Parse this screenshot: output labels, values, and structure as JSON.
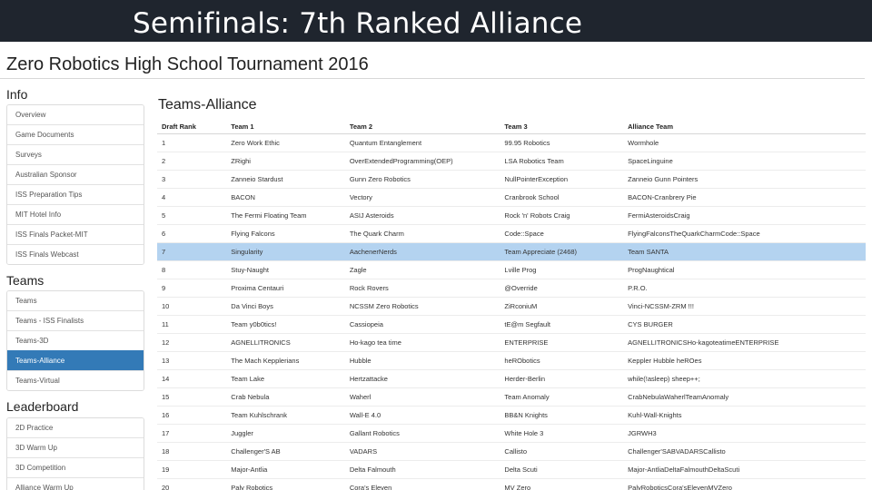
{
  "banner": {
    "title": "Semifinals: 7th Ranked Alliance"
  },
  "site": {
    "title": "Zero Robotics High School Tournament 2016"
  },
  "sidebar": {
    "info": {
      "heading": "Info",
      "items": [
        "Overview",
        "Game Documents",
        "Surveys",
        "Australian Sponsor",
        "ISS Preparation Tips",
        "MIT Hotel Info",
        "ISS Finals Packet-MIT",
        "ISS Finals Webcast"
      ]
    },
    "teams": {
      "heading": "Teams",
      "items": [
        "Teams",
        "Teams - ISS Finalists",
        "Teams-3D",
        "Teams-Alliance",
        "Teams-Virtual"
      ],
      "active": "Teams-Alliance"
    },
    "leaderboard": {
      "heading": "Leaderboard",
      "items": [
        "2D Practice",
        "3D Warm Up",
        "3D Competition",
        "Alliance Warm Up"
      ]
    }
  },
  "main": {
    "heading": "Teams-Alliance",
    "columns": [
      "Draft Rank",
      "Team 1",
      "Team 2",
      "Team 3",
      "Alliance Team"
    ],
    "selected_rank": "7",
    "rows": [
      [
        "1",
        "Zero Work Ethic",
        "Quantum Entanglement",
        "99.95 Robotics",
        "Wormhole"
      ],
      [
        "2",
        "ZRighi",
        "OverExtendedProgramming(OEP)",
        "LSA Robotics Team",
        "SpaceLinguine"
      ],
      [
        "3",
        "Zanneio Stardust",
        "Gunn Zero Robotics",
        "NullPointerException",
        "Zanneio Gunn Pointers"
      ],
      [
        "4",
        "BACON",
        "Vectory",
        "Cranbrook School",
        "BACON-Cranbrery Pie"
      ],
      [
        "5",
        "The Fermi Floating Team",
        "ASIJ Asteroids",
        "Rock 'n' Robots Craig",
        "FermiAsteroidsCraig"
      ],
      [
        "6",
        "Flying Falcons",
        "The Quark Charm",
        "Code::Space",
        "FlyingFalconsTheQuarkCharmCode::Space"
      ],
      [
        "7",
        "Singularity",
        "AachenerNerds",
        "Team Appreciate (2468)",
        "Team SANTA"
      ],
      [
        "8",
        "Stuy-Naught",
        "Zagle",
        "Lville Prog",
        "ProgNaughtical"
      ],
      [
        "9",
        "Proxima Centauri",
        "Rock Rovers",
        "@Override",
        "P.R.O."
      ],
      [
        "10",
        "Da Vinci Boys",
        "NCSSM Zero Robotics",
        "ZiRconiuM",
        "Vinci-NCSSM-ZRM !!!"
      ],
      [
        "11",
        "Team y0b0tics!",
        "Cassiopeia",
        "tE@m Segfault",
        "CYS BURGER"
      ],
      [
        "12",
        "AGNELLITRONICS",
        "Ho-kago tea time",
        "ENTERPRISE",
        "AGNELLITRONICSHo-kagoteatimeENTERPRISE"
      ],
      [
        "13",
        "The Mach Kepplerians",
        "Hubble",
        "heRObotics",
        "Keppler Hubble heROes"
      ],
      [
        "14",
        "Team Lake",
        "Hertzattacke",
        "Herder-Berlin",
        "while(!asleep) sheep++;"
      ],
      [
        "15",
        "Crab Nebula",
        "Waherl",
        "Team Anomaly",
        "CrabNebulaWaherlTeamAnomaly"
      ],
      [
        "16",
        "Team Kuhlschrank",
        "Wall-E 4.0",
        "BB&N Knights",
        "Kuhl-Wall-Knights"
      ],
      [
        "17",
        "Juggler",
        "Gallant Robotics",
        "White Hole 3",
        "JGRWH3"
      ],
      [
        "18",
        "Challenger'S AB",
        "VADARS",
        "Callisto",
        "Challenger'SABVADARSCallisto"
      ],
      [
        "19",
        "Major-Antlia",
        "Delta Falmouth",
        "Delta Scuti",
        "Major-AntliaDeltaFalmouthDeltaScuti"
      ],
      [
        "20",
        "Paly Robotics",
        "Cora's Eleven",
        "MV Zero",
        "PalyRoboticsCora'sElevenMVZero"
      ]
    ]
  }
}
